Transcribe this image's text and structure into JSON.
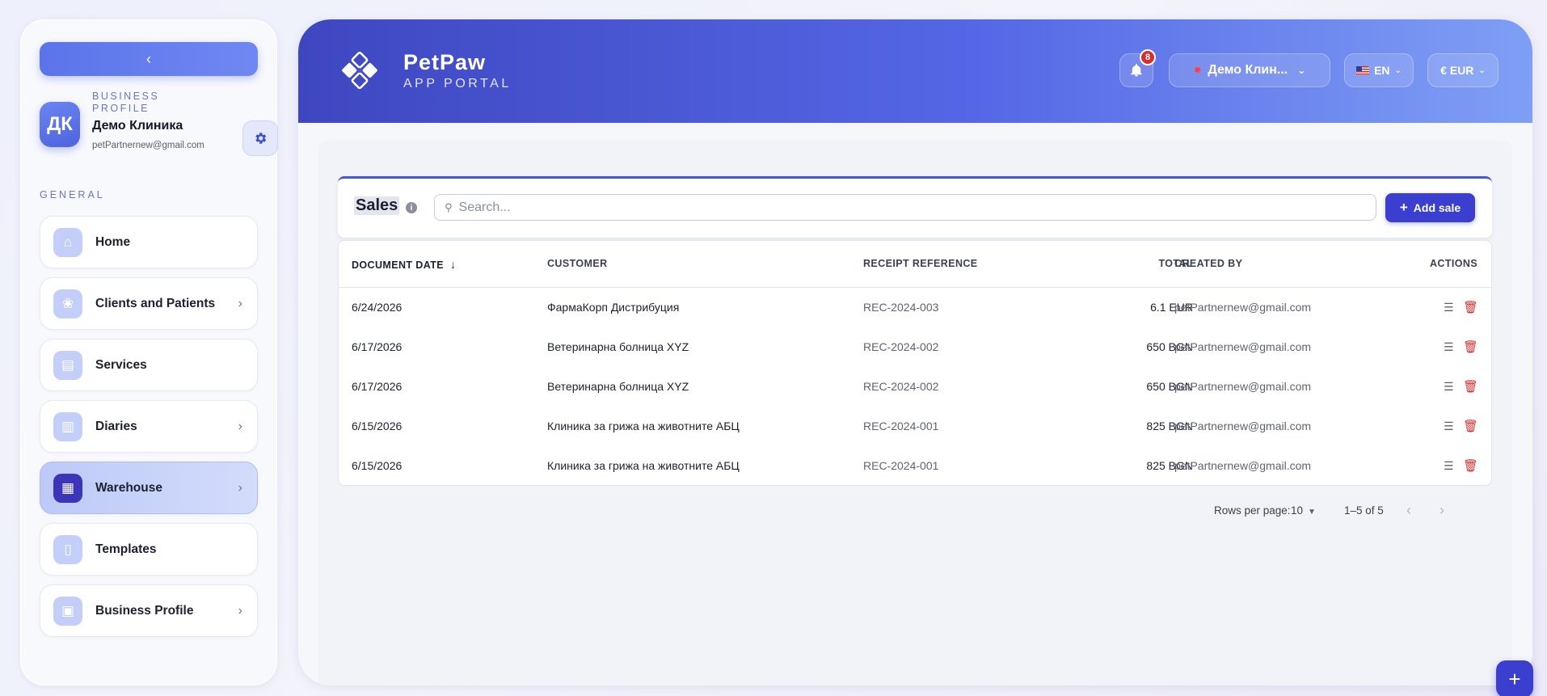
{
  "sidebar": {
    "collapse_icon": "chevron-left-icon",
    "profile": {
      "initials": "ДК",
      "kicker": "BUSINESS PROFILE",
      "name": "Демо Клиника",
      "email": "petPartnernew@gmail.com"
    },
    "section_label": "GENERAL",
    "items": [
      {
        "label": "Home",
        "icon": "home-icon",
        "chevron": false,
        "active": false
      },
      {
        "label": "Clients and Patients",
        "icon": "paw-icon",
        "chevron": true,
        "active": false
      },
      {
        "label": "Services",
        "icon": "clipboard-icon",
        "chevron": false,
        "active": false
      },
      {
        "label": "Diaries",
        "icon": "book-icon",
        "chevron": true,
        "active": false
      },
      {
        "label": "Warehouse",
        "icon": "warehouse-icon",
        "chevron": true,
        "active": true
      },
      {
        "label": "Templates",
        "icon": "document-icon",
        "chevron": false,
        "active": false
      },
      {
        "label": "Business Profile",
        "icon": "business-icon",
        "chevron": true,
        "active": false
      }
    ]
  },
  "header": {
    "brand_name": "PetPaw",
    "brand_sub": "APP PORTAL",
    "notifications_count": "8",
    "clinic": "Демо Клин...",
    "language": "EN",
    "currency": "€ EUR"
  },
  "sales": {
    "title": "Sales",
    "search_placeholder": "Search...",
    "add_label": "Add sale",
    "columns": {
      "date": "DOCUMENT DATE",
      "customer": "CUSTOMER",
      "receipt": "RECEIPT REFERENCE",
      "total": "TOTAL",
      "created_by": "CREATED BY",
      "actions": "ACTIONS"
    },
    "rows": [
      {
        "date": "6/24/2026",
        "customer": "ФармаКорп Дистрибуция",
        "receipt": "REC-2024-003",
        "total": "6.1 EUR",
        "created_by": "petPartnernew@gmail.com"
      },
      {
        "date": "6/17/2026",
        "customer": "Ветеринарна болница XYZ",
        "receipt": "REC-2024-002",
        "total": "650 BGN",
        "created_by": "petPartnernew@gmail.com"
      },
      {
        "date": "6/17/2026",
        "customer": "Ветеринарна болница XYZ",
        "receipt": "REC-2024-002",
        "total": "650 BGN",
        "created_by": "petPartnernew@gmail.com"
      },
      {
        "date": "6/15/2026",
        "customer": "Клиника за грижа на животните АБЦ",
        "receipt": "REC-2024-001",
        "total": "825 BGN",
        "created_by": "petPartnernew@gmail.com"
      },
      {
        "date": "6/15/2026",
        "customer": "Клиника за грижа на животните АБЦ",
        "receipt": "REC-2024-001",
        "total": "825 BGN",
        "created_by": "petPartnernew@gmail.com"
      }
    ],
    "pagination": {
      "rows_per_page_label": "Rows per page:",
      "rows_per_page": "10",
      "range": "1–5 of 5"
    }
  },
  "colors": {
    "accent": "#3b3fcf",
    "header_start": "#3e47c0",
    "header_end": "#7f9ff5",
    "danger": "#d32f2f"
  }
}
